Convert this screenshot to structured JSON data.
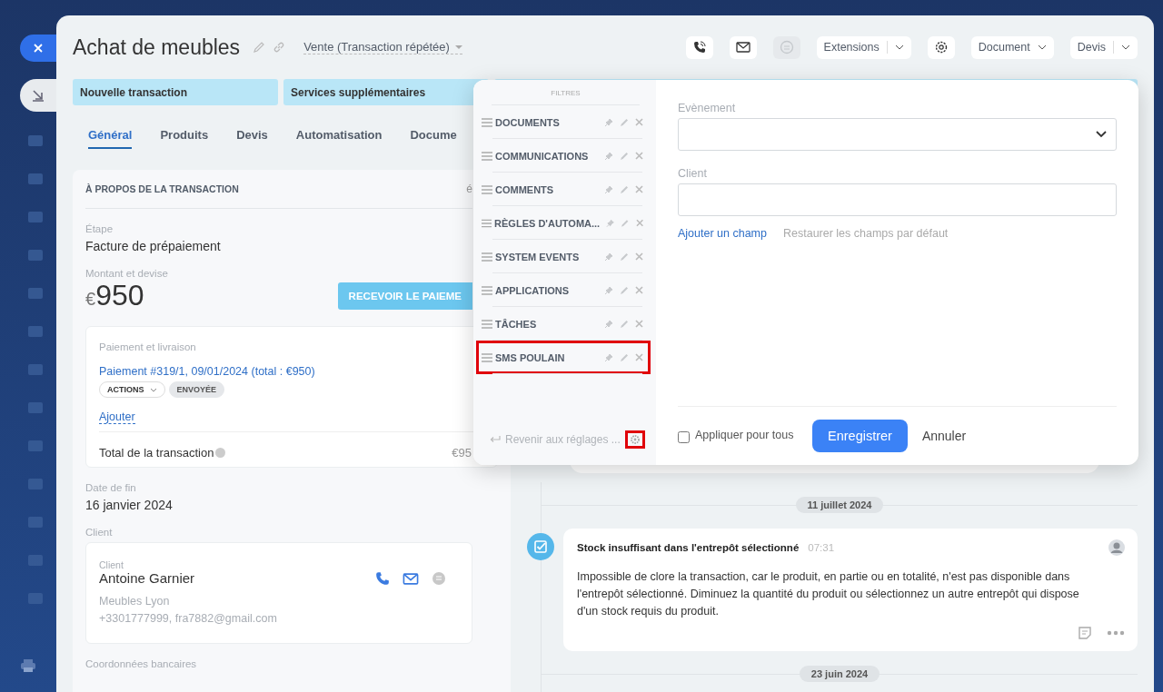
{
  "window": {
    "title": "Achat de meubles",
    "category": "Vente (Transaction répétée)"
  },
  "icon_buttons": [
    {
      "kind": "phone",
      "disabled": false
    },
    {
      "kind": "mail",
      "disabled": false
    },
    {
      "kind": "chat",
      "disabled": true
    }
  ],
  "toolbar": [
    {
      "label": "Extensions",
      "kind": "split"
    },
    {
      "kind": "settings"
    },
    {
      "label": "Document",
      "kind": "dropdown"
    },
    {
      "label": "Devis",
      "kind": "split"
    }
  ],
  "stages": [
    {
      "label": "Nouvelle transaction"
    },
    {
      "label": "Services supplémentaires"
    }
  ],
  "tabs": [
    {
      "label": "Général",
      "selected": true
    },
    {
      "label": "Produits",
      "selected": false
    },
    {
      "label": "Devis",
      "selected": false
    },
    {
      "label": "Automatisation",
      "selected": false
    },
    {
      "label": "Docume",
      "selected": false
    }
  ],
  "about": {
    "title": "À PROPOS DE LA TRANSACTION",
    "edit_hint": "é",
    "stage_label": "Étape",
    "stage_value": "Facture de prépaiement",
    "amount_label": "Montant et devise",
    "currency": "€",
    "amount": "950",
    "receive_button": "RECEVOIR LE PAIEME",
    "payment": {
      "title": "Paiement et livraison",
      "link": "Paiement #319/1, 09/01/2024 (total : €950)",
      "actions": "ACTIONS",
      "status": "ENVOYÉE",
      "add": "Ajouter",
      "total_label": "Total de la transaction",
      "total": "€95"
    },
    "end_label": "Date de fin",
    "end_value": "16 janvier 2024",
    "client_section": "Client",
    "client": {
      "label": "Client",
      "name": "Antoine Garnier",
      "company": "Meubles Lyon",
      "contact": "+3301777999, fra7882@gmail.com"
    },
    "bank_label": "Coordonnées bancaires"
  },
  "timeline": [
    {
      "kind": "date",
      "label": "11 juillet 2024"
    },
    {
      "kind": "event",
      "title": "Stock insuffisant dans l'entrepôt sélectionné",
      "time": "07:31",
      "text": "Impossible de clore la transaction, car le produit, en partie ou en totalité, n'est pas disponible dans l'entrepôt sélectionné. Diminuez la quantité du produit ou sélectionnez un autre entrepôt qui dispose d'un stock requis du produit."
    },
    {
      "kind": "date",
      "label": "23 juin 2024"
    }
  ],
  "popup": {
    "filters_title": "FILTRES",
    "filters": [
      {
        "label": "DOCUMENTS",
        "highlighted": false
      },
      {
        "label": "COMMUNICATIONS",
        "highlighted": false
      },
      {
        "label": "COMMENTS",
        "highlighted": false
      },
      {
        "label": "RÈGLES D'AUTOMA...",
        "highlighted": false
      },
      {
        "label": "SYSTEM EVENTS",
        "highlighted": false
      },
      {
        "label": "APPLICATIONS",
        "highlighted": false
      },
      {
        "label": "TÂCHES",
        "highlighted": false
      },
      {
        "label": "SMS POULAIN",
        "highlighted": true
      }
    ],
    "reset": "Revenir aux réglages ...",
    "reset_settings_highlighted": true,
    "fields": [
      {
        "label": "Evènement",
        "kind": "select"
      },
      {
        "label": "Client",
        "kind": "text"
      }
    ],
    "add_field": "Ajouter un champ",
    "restore": "Restaurer les champs par défaut",
    "apply_all": {
      "label": "Appliquer pour tous",
      "checked": false
    },
    "save": "Enregistrer",
    "cancel": "Annuler"
  }
}
